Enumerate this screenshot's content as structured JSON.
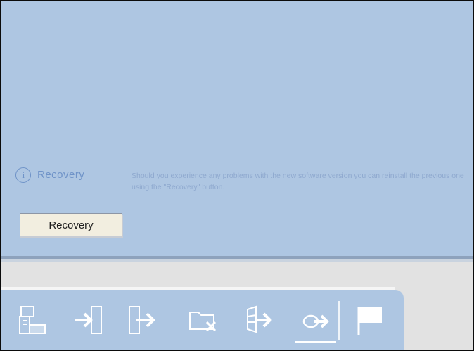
{
  "info": {
    "icon": "info-icon",
    "icon_glyph": "i",
    "title": "Recovery",
    "text": "Should you experience any problems with the new software version you can reinstall the previous one using the \"Recovery\" button."
  },
  "buttons": {
    "recovery_label": "Recovery"
  },
  "toolbar": {
    "icons": [
      "computer-setup-icon",
      "import-icon",
      "export-icon",
      "folder-delete-icon",
      "firmware-update-icon",
      "recovery-icon",
      "flag-icon"
    ],
    "active": "recovery-icon"
  },
  "colors": {
    "panel_blue": "#aec6e2",
    "info_blue": "#6f93c8",
    "button_bg": "#f2eee0",
    "frame": "#0b0b0b"
  }
}
